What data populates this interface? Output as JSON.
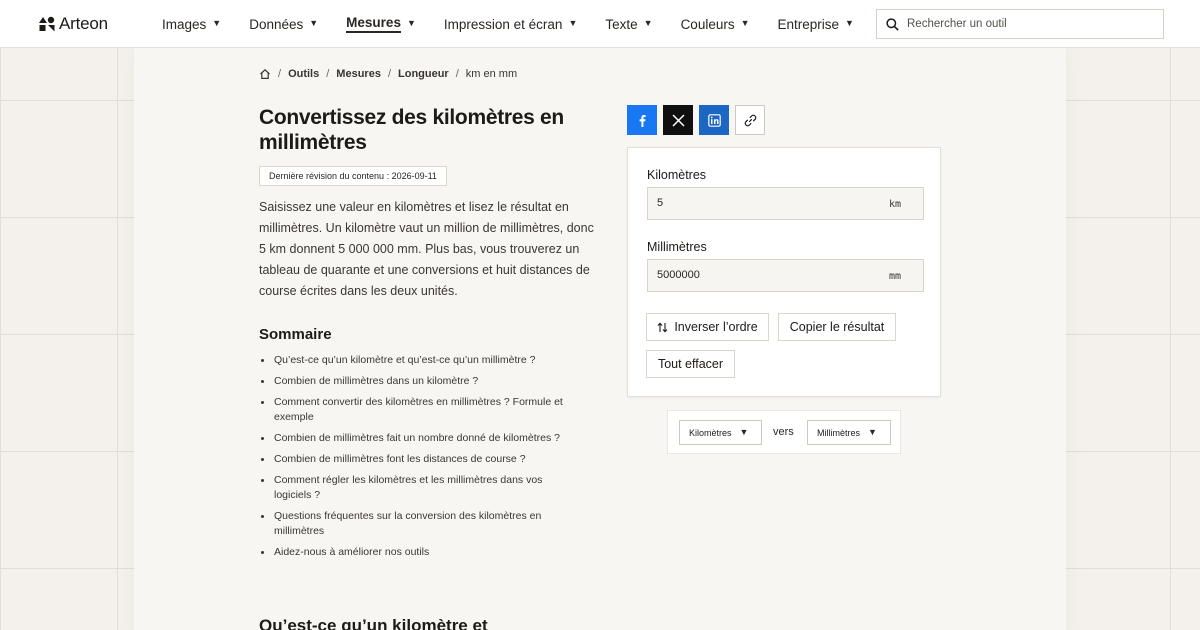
{
  "brand": {
    "name": "Arteon"
  },
  "nav": {
    "items": [
      {
        "label": "Images",
        "active": false
      },
      {
        "label": "Données",
        "active": false
      },
      {
        "label": "Mesures",
        "active": true
      },
      {
        "label": "Impression et écran",
        "active": false
      },
      {
        "label": "Texte",
        "active": false
      },
      {
        "label": "Couleurs",
        "active": false
      },
      {
        "label": "Entreprise",
        "active": false
      }
    ],
    "caret": "▼"
  },
  "search": {
    "placeholder": "Rechercher un outil"
  },
  "breadcrumb": {
    "separator": "/",
    "items": [
      "Outils",
      "Mesures",
      "Longueur"
    ],
    "current": "km en mm"
  },
  "article": {
    "title": "Convertissez des kilomètres en millimètres",
    "revision": "Dernière révision du contenu : 2026-09-11",
    "intro": "Saisissez une valeur en kilomètres et lisez le résultat en millimètres. Un kilomètre vaut un million de millimètres, donc 5 km donnent 5 000 000 mm. Plus bas, vous trouverez un tableau de quarante et une conversions et huit distances de course écrites dans les deux unités.",
    "toc_title": "Sommaire",
    "toc": [
      "Qu’est-ce qu’un kilomètre et qu’est-ce qu’un millimètre ?",
      "Combien de millimètres dans un kilomètre ?",
      "Comment convertir des kilomètres en millimètres ? Formule et exemple",
      "Combien de millimètres fait un nombre donné de kilomètres ?",
      "Combien de millimètres font les distances de course ?",
      "Comment régler les kilomètres et les millimètres dans vos logiciels ?",
      "Questions fréquentes sur la conversion des kilomètres en millimètres",
      "Aidez-nous à améliorer nos outils"
    ],
    "next_heading": "Qu’est-ce qu’un kilomètre et"
  },
  "share": {
    "buttons": [
      {
        "icon": "facebook-icon",
        "color": "#1877f2"
      },
      {
        "icon": "x-icon",
        "color": "#0f0f0f"
      },
      {
        "icon": "linkedin-icon",
        "color": "#1c66c4"
      },
      {
        "icon": "link-icon",
        "color": "#ffffff"
      }
    ]
  },
  "converter": {
    "from": {
      "label": "Kilomètres",
      "value": "5",
      "unit": "km"
    },
    "to": {
      "label": "Millimètres",
      "value": "5000000",
      "unit": "mm"
    },
    "swap_label": "Inverser l’ordre",
    "copy_label": "Copier le résultat",
    "clear_label": "Tout effacer"
  },
  "unit_selector": {
    "from": "Kilomètres",
    "connector": "vers",
    "to": "Millimètres"
  }
}
